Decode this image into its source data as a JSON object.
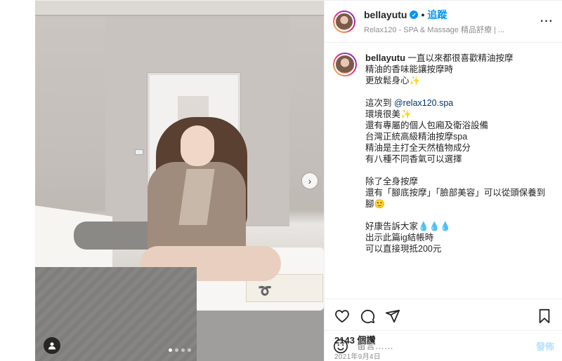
{
  "header": {
    "username": "bellayutu",
    "separator": "•",
    "follow_label": "追蹤",
    "location": "Relax120 - SPA & Massage 精品舒療 | ...",
    "more_label": "···"
  },
  "caption": {
    "username": "bellayutu",
    "line1": " 一直以來都很喜歡精油按摩\n精油的香味能讓按摩時\n更放鬆身心✨\n\n這次到 ",
    "mention": "@relax120.spa",
    "line2": "\n環境很美✨\n還有專屬的個人包廂及衛浴設備\n台灣正統高級精油按摩spa\n精油是主打全天然植物成分\n有八種不同香氣可以選擇\n\n除了全身按摩\n還有「腳底按摩」「臉部美容」可以從頭保養到腳🙂\n\n好康告訴大家💧💧💧\n出示此篇ig結帳時\n可以直接現抵200元"
  },
  "likes": "2143 個讚",
  "date": "2021年9月4日",
  "comment": {
    "placeholder": "留言……",
    "post_label": "發佈"
  },
  "media": {
    "next_glyph": "›",
    "carousel_count": 4,
    "carousel_active": 0
  },
  "colors": {
    "accent": "#0095f6",
    "post_disabled": "#b2dffc",
    "meta_gray": "#8e8e8e"
  }
}
